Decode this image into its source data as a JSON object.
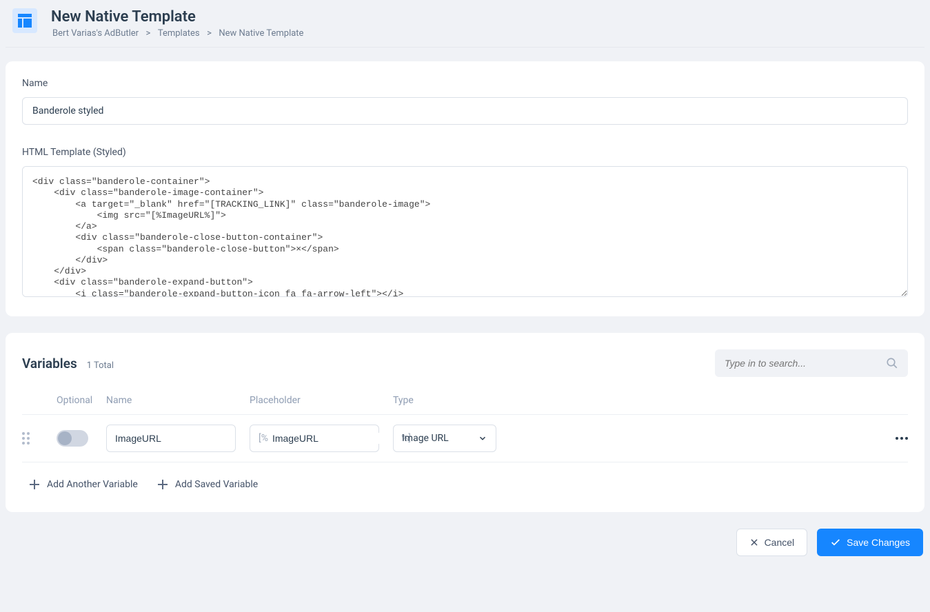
{
  "header": {
    "title": "New Native Template",
    "breadcrumb": [
      "Bert Varias's AdButler",
      "Templates",
      "New Native Template"
    ]
  },
  "form": {
    "name_label": "Name",
    "name_value": "Banderole styled",
    "template_label": "HTML Template (Styled)",
    "template_value": "<div class=\"banderole-container\">\n    <div class=\"banderole-image-container\">\n        <a target=\"_blank\" href=\"[TRACKING_LINK]\" class=\"banderole-image\">\n            <img src=\"[%ImageURL%]\">\n        </a>\n        <div class=\"banderole-close-button-container\">\n            <span class=\"banderole-close-button\">×</span>\n        </div>\n    </div>\n    <div class=\"banderole-expand-button\">\n        <i class=\"banderole-expand-button-icon fa fa-arrow-left\"></i>"
  },
  "variables": {
    "title": "Variables",
    "count_label": "1 Total",
    "search_placeholder": "Type in to search...",
    "columns": {
      "optional": "Optional",
      "name": "Name",
      "placeholder": "Placeholder",
      "type": "Type"
    },
    "rows": [
      {
        "name": "ImageURL",
        "placeholder": "ImageURL",
        "type": "Image URL"
      }
    ],
    "placeholder_prefix": "[%",
    "placeholder_suffix": "%]",
    "add_another": "Add Another Variable",
    "add_saved": "Add Saved Variable"
  },
  "footer": {
    "cancel": "Cancel",
    "save": "Save Changes"
  }
}
